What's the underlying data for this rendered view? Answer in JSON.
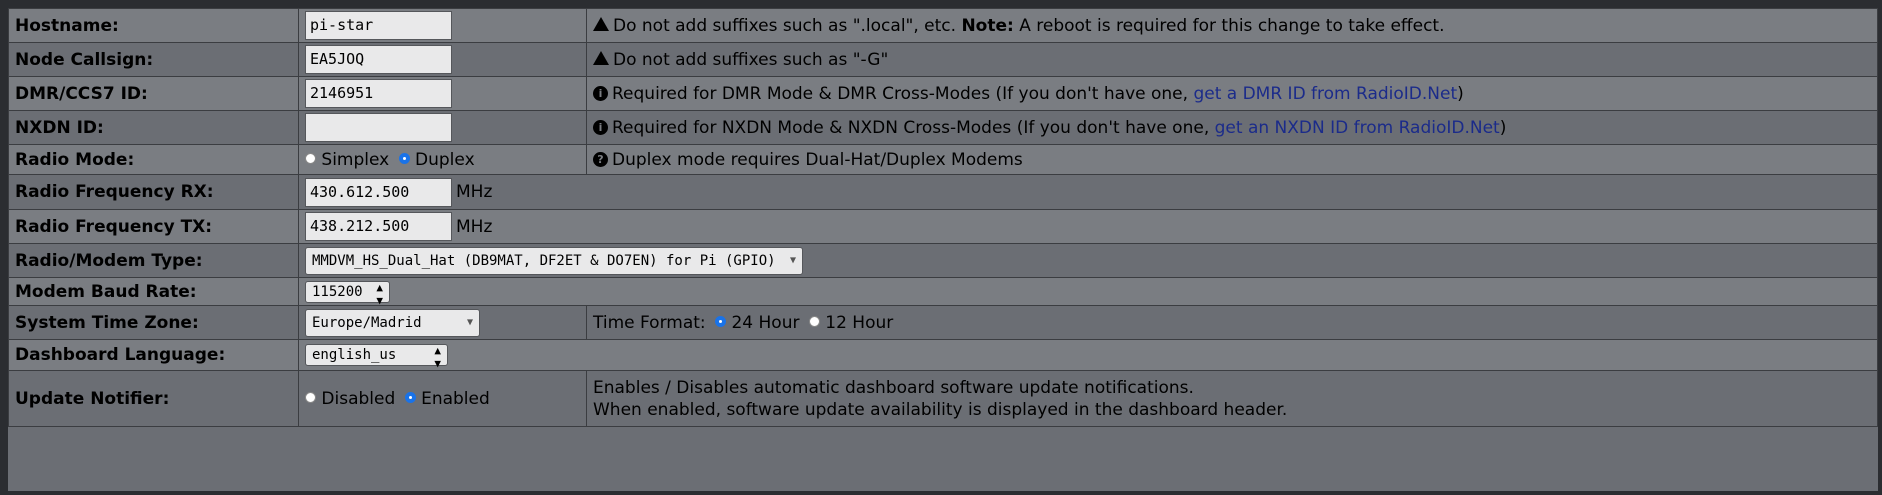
{
  "rows": {
    "hostname": {
      "label": "Hostname:",
      "value": "pi-star",
      "note_pre": "Do not add suffixes such as \".local\", etc. ",
      "note_bold": "Note:",
      "note_post": " A reboot is required for this change to take effect.",
      "icon": "warning-icon"
    },
    "callsign": {
      "label": "Node Callsign:",
      "value": "EA5JOQ",
      "note": "Do not add suffixes such as \"-G\"",
      "icon": "warning-icon"
    },
    "dmr": {
      "label": "DMR/CCS7 ID:",
      "value": "2146951",
      "note_pre": "Required for DMR Mode & DMR Cross-Modes (If you don't have one, ",
      "link": "get a DMR ID from RadioID.Net",
      "note_post": ")",
      "icon": "info-icon"
    },
    "nxdn": {
      "label": "NXDN ID:",
      "value": "",
      "note_pre": "Required for NXDN Mode & NXDN Cross-Modes (If you don't have one, ",
      "link": "get an NXDN ID from RadioID.Net",
      "note_post": ")",
      "icon": "info-icon"
    },
    "mode": {
      "label": "Radio Mode:",
      "opt1": "Simplex",
      "opt2": "Duplex",
      "selected": "Duplex",
      "note": "Duplex mode requires Dual-Hat/Duplex Modems",
      "icon": "question-icon"
    },
    "rx": {
      "label": "Radio Frequency RX:",
      "value": "430.612.500",
      "unit": "MHz"
    },
    "tx": {
      "label": "Radio Frequency TX:",
      "value": "438.212.500",
      "unit": "MHz"
    },
    "modem": {
      "label": "Radio/Modem Type:",
      "value": "MMDVM_HS_Dual_Hat (DB9MAT, DF2ET & DO7EN) for Pi (GPIO)"
    },
    "baud": {
      "label": "Modem Baud Rate:",
      "value": "115200"
    },
    "tz": {
      "label": "System Time Zone:",
      "value": "Europe/Madrid",
      "time_label": "Time Format:",
      "opt1": "24 Hour",
      "opt2": "12 Hour",
      "selected": "24 Hour"
    },
    "lang": {
      "label": "Dashboard Language:",
      "value": "english_us"
    },
    "update": {
      "label": "Update Notifier:",
      "opt1": "Disabled",
      "opt2": "Enabled",
      "selected": "Enabled",
      "note1": "Enables / Disables automatic dashboard software update notifications.",
      "note2": "When enabled, software update availability is displayed in the dashboard header."
    }
  }
}
